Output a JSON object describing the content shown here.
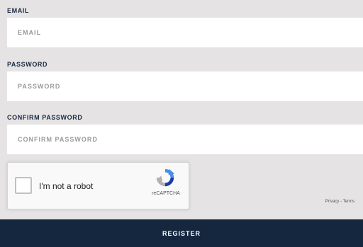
{
  "form": {
    "email": {
      "label": "EMAIL",
      "placeholder": "EMAIL",
      "value": ""
    },
    "password": {
      "label": "PASSWORD",
      "placeholder": "PASSWORD",
      "value": ""
    },
    "confirm_password": {
      "label": "CONFIRM PASSWORD",
      "placeholder": "CONFIRM PASSWORD",
      "value": ""
    }
  },
  "captcha": {
    "checkbox_label": "I'm not a robot",
    "brand": "reCAPTCHA",
    "terms": "Privacy - Terms",
    "logo_icon": "recaptcha-logo-icon"
  },
  "submit": {
    "label": "REGISTER"
  },
  "colors": {
    "background": "#e5e3e3",
    "label_text": "#1b2a44",
    "button_background": "#14273f",
    "button_text": "#ffffff"
  }
}
